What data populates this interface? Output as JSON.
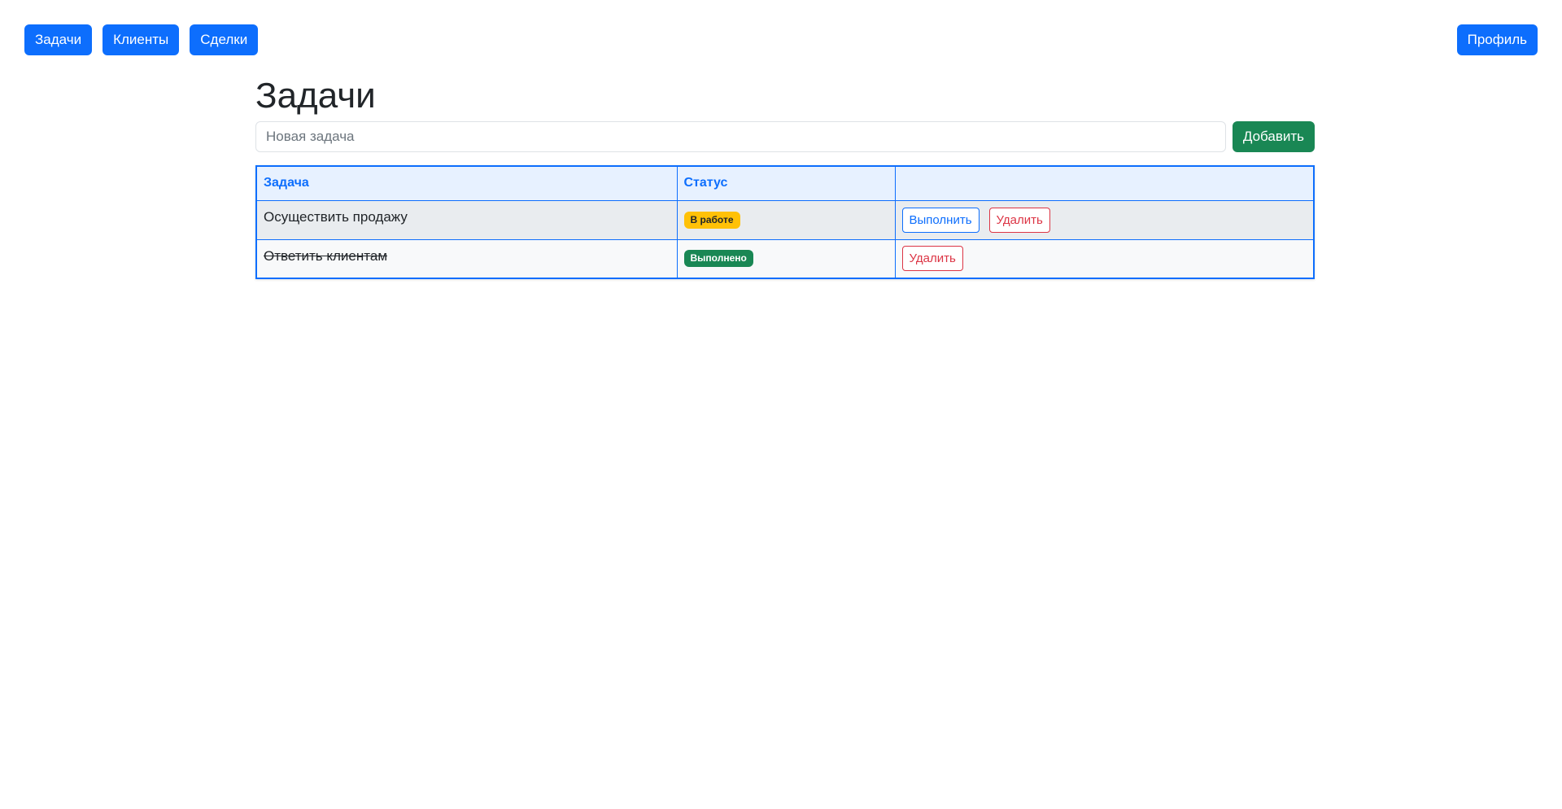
{
  "nav": {
    "items": [
      {
        "label": "Задачи"
      },
      {
        "label": "Клиенты"
      },
      {
        "label": "Сделки"
      }
    ],
    "profile_label": "Профиль"
  },
  "page": {
    "title": "Задачи"
  },
  "add_form": {
    "placeholder": "Новая задача",
    "value": "",
    "add_label": "Добавить"
  },
  "table": {
    "headers": [
      "Задача",
      "Статус",
      ""
    ],
    "rows": [
      {
        "task": "Осуществить продажу",
        "done": false,
        "status": "В работе",
        "status_color": "#ffc107",
        "complete_label": "Выполнить",
        "delete_label": "Удалить"
      },
      {
        "task": "Ответить клиентам",
        "done": true,
        "status": "Выполнено",
        "status_color": "#198754",
        "delete_label": "Удалить"
      }
    ]
  },
  "colors": {
    "primary": "#0d6efd",
    "success": "#198754",
    "warning": "#ffc107",
    "danger": "#dc3545"
  }
}
